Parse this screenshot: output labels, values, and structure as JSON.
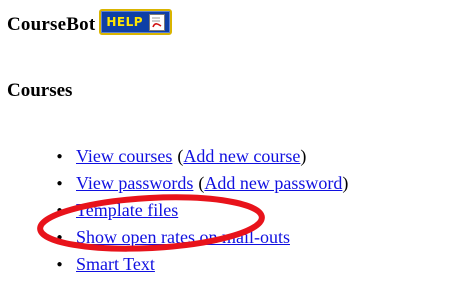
{
  "header": {
    "app_title": "CourseBot",
    "help_button_label": "HELP"
  },
  "section": {
    "title": "Courses"
  },
  "courses_menu": {
    "items": [
      {
        "link": "View courses",
        "secondary_link": "Add new course"
      },
      {
        "link": "View passwords",
        "secondary_link": "Add new password"
      },
      {
        "link": "Template files"
      },
      {
        "link": "Show open rates on mail-outs"
      },
      {
        "link": "Smart Text"
      }
    ],
    "open_paren": "(",
    "close_paren": ")"
  },
  "colors": {
    "link": "#1010e0",
    "highlight_ellipse": "#e8131b",
    "help_button_bg": "#0e3fa6",
    "help_button_text": "#ffe600"
  }
}
